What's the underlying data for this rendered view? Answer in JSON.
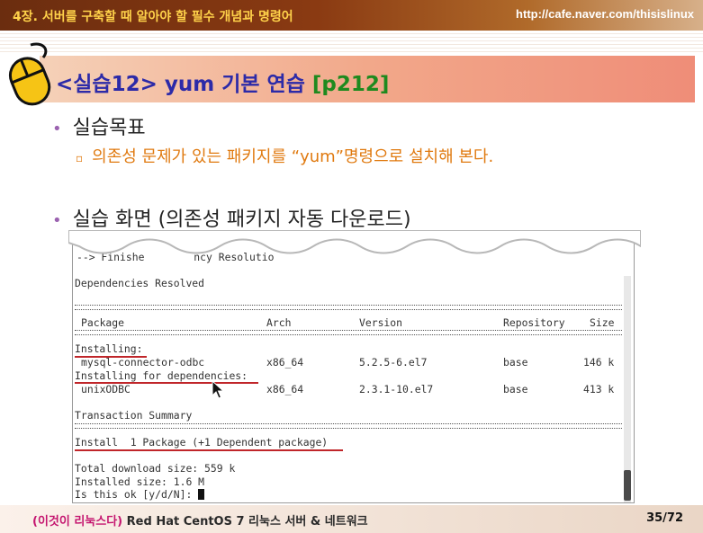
{
  "header": {
    "chapter": "4장. 서버를 구축할 때 알아야 할 필수 개념과 명령어",
    "url": "http://cafe.naver.com/thisislinux"
  },
  "title": {
    "main": "<실습12> yum 기본 연습",
    "page_ref": "[p212]"
  },
  "bullets": [
    {
      "label": "실습목표",
      "sub": "의존성 문제가 있는 패키지를 “yum”명령으로 설치해 본다."
    },
    {
      "label": "실습 화면 (의존성 패키지 자동 다운로드)"
    }
  ],
  "terminal": {
    "partial_line": "--> Finishe        ncy Resolutio",
    "resolved": "Dependencies Resolved",
    "columns": [
      "Package",
      "Arch",
      "Version",
      "Repository",
      "Size"
    ],
    "installing_label": "Installing:",
    "installing_row": {
      "package": "mysql-connector-odbc",
      "arch": "x86_64",
      "version": "5.2.5-6.el7",
      "repo": "base",
      "size": "146 k"
    },
    "deps_label": "Installing for dependencies:",
    "deps_row": {
      "package": "unixODBC",
      "arch": "x86_64",
      "version": "2.3.1-10.el7",
      "repo": "base",
      "size": "413 k"
    },
    "summary_label": "Transaction Summary",
    "install_line": "Install  1 Package (+1 Dependent package)",
    "download_size": "Total download size: 559 k",
    "installed_size": "Installed size: 1.6 M",
    "prompt": "Is this ok [y/d/N]: "
  },
  "footer": {
    "book_paren": "(이것이 리눅스다)",
    "book_title": "Red Hat CentOS 7 리눅스 서버 & 네트워크",
    "page_number": "35/72"
  },
  "colors": {
    "header_bg": "#6b2d0f",
    "chapter_text": "#ffd24a",
    "title_text": "#2c2aa8",
    "page_ref": "#1f8a1f",
    "sub_text": "#e07a10",
    "underline": "#c0262a"
  },
  "icons": [
    "mouse-icon",
    "mouse-pointer-icon"
  ]
}
